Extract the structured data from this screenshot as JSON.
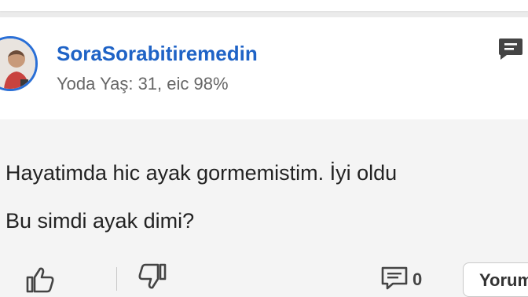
{
  "post": {
    "username": "SoraSorabitiremedin",
    "meta": "Yoda Yaş: 31, eic 98%",
    "lines": [
      "Hayatimda hic ayak gormemistim. İyi oldu",
      "Bu simdi ayak dimi?"
    ]
  },
  "actions": {
    "comment_count": "0",
    "reply_label": "Yorum"
  },
  "colors": {
    "accent": "#1f63c6",
    "avatar_ring": "#2a6fd6",
    "icon": "#444444"
  },
  "icons": {
    "header_action": "message-icon",
    "like": "thumbs-up-icon",
    "dislike": "thumbs-down-icon",
    "comment": "comment-icon"
  }
}
